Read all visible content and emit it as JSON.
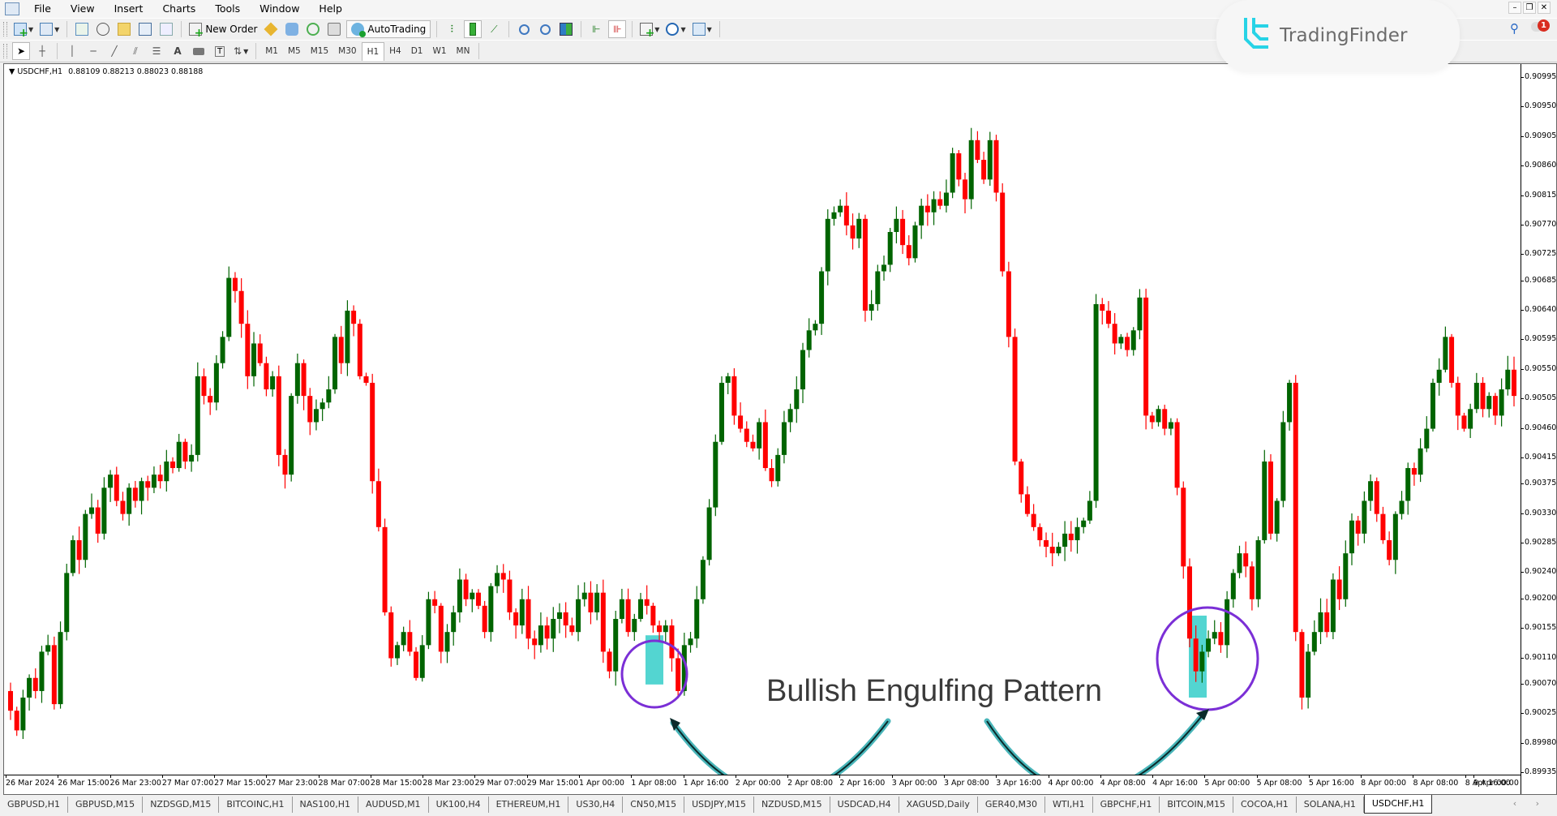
{
  "app": {
    "symbol_title": "USDCHF,H1",
    "ohlc_readout": "0.88109 0.88213 0.88023 0.88188"
  },
  "menu": [
    "File",
    "View",
    "Insert",
    "Charts",
    "Tools",
    "Window",
    "Help"
  ],
  "toolbar": {
    "new_order_label": "New Order",
    "autotrading_label": "AutoTrading",
    "timeframes": [
      "M1",
      "M5",
      "M15",
      "M30",
      "H1",
      "H4",
      "D1",
      "W1",
      "MN"
    ],
    "active_timeframe": "H1"
  },
  "branding": {
    "logo_text": "TradingFinder",
    "notification_count": "1"
  },
  "window_controls": {
    "minimize": "–",
    "restore": "❐",
    "close": "✕"
  },
  "colors": {
    "bull": "#006400",
    "bear": "#ff0000",
    "highlight": "#40d0cc",
    "circle": "#7b2fd6",
    "arrow": "#1aa3a8"
  },
  "annotation": {
    "label": "Bullish Engulfing Pattern"
  },
  "tabs": [
    "GBPUSD,H1",
    "GBPUSD,M15",
    "NZDSGD,M15",
    "BITCOINC,H1",
    "NAS100,H1",
    "AUDUSD,M1",
    "UK100,H4",
    "ETHEREUM,H1",
    "US30,H4",
    "CN50,M15",
    "USDJPY,M15",
    "NZDUSD,M15",
    "USDCAD,H4",
    "XAGUSD,Daily",
    "GER40,M30",
    "WTI,H1",
    "GBPCHF,H1",
    "BITCOIN,M15",
    "COCOA,H1",
    "SOLANA,H1",
    "USDCHF,H1"
  ],
  "active_tab": "USDCHF,H1",
  "chart_data": {
    "type": "candlestick",
    "title": "USDCHF,H1",
    "ylim": [
      0.89935,
      0.90995
    ],
    "y_ticks": [
      "0.90995",
      "0.90950",
      "0.90905",
      "0.90860",
      "0.90815",
      "0.90770",
      "0.90725",
      "0.90685",
      "0.90640",
      "0.90595",
      "0.90550",
      "0.90505",
      "0.90460",
      "0.90415",
      "0.90375",
      "0.90330",
      "0.90285",
      "0.90240",
      "0.90200",
      "0.90155",
      "0.90110",
      "0.90070",
      "0.90025",
      "0.89980",
      "0.89935"
    ],
    "x_ticks": [
      "26 Mar 2024",
      "26 Mar 15:00",
      "26 Mar 23:00",
      "27 Mar 07:00",
      "27 Mar 15:00",
      "27 Mar 23:00",
      "28 Mar 07:00",
      "28 Mar 15:00",
      "28 Mar 23:00",
      "29 Mar 07:00",
      "29 Mar 15:00",
      "1 Apr 00:00",
      "1 Apr 08:00",
      "1 Apr 16:00",
      "2 Apr 00:00",
      "2 Apr 08:00",
      "2 Apr 16:00",
      "3 Apr 00:00",
      "3 Apr 08:00",
      "3 Apr 16:00",
      "4 Apr 00:00",
      "4 Apr 08:00",
      "4 Apr 16:00",
      "5 Apr 00:00",
      "5 Apr 08:00",
      "5 Apr 16:00",
      "8 Apr 00:00",
      "8 Apr 08:00",
      "8 Apr 16:00",
      "9 Apr 00:00"
    ],
    "close_path": [
      0.9003,
      0.9,
      0.9005,
      0.9008,
      0.9006,
      0.9012,
      0.9013,
      0.9004,
      0.9015,
      0.9024,
      0.9029,
      0.9026,
      0.9033,
      0.9034,
      0.903,
      0.9037,
      0.9039,
      0.9035,
      0.9033,
      0.9037,
      0.9035,
      0.9038,
      0.9037,
      0.9039,
      0.9038,
      0.9041,
      0.904,
      0.9044,
      0.9041,
      0.9042,
      0.9054,
      0.9051,
      0.905,
      0.9056,
      0.906,
      0.9069,
      0.9067,
      0.9062,
      0.9054,
      0.9059,
      0.9056,
      0.9052,
      0.9054,
      0.9042,
      0.9039,
      0.9051,
      0.9056,
      0.9051,
      0.9047,
      0.9049,
      0.905,
      0.9052,
      0.906,
      0.9056,
      0.9064,
      0.9062,
      0.9054,
      0.9053,
      0.9038,
      0.9031,
      0.9018,
      0.9011,
      0.9013,
      0.9015,
      0.9012,
      0.9008,
      0.9013,
      0.902,
      0.9019,
      0.9012,
      0.9015,
      0.9018,
      0.9023,
      0.902,
      0.9021,
      0.9019,
      0.9015,
      0.9022,
      0.9024,
      0.9023,
      0.9018,
      0.9016,
      0.902,
      0.9014,
      0.9013,
      0.9016,
      0.9014,
      0.9017,
      0.9018,
      0.9016,
      0.9015,
      0.902,
      0.9021,
      0.9018,
      0.9021,
      0.9012,
      0.9009,
      0.9017,
      0.902,
      0.9015,
      0.9017,
      0.902,
      0.9019,
      0.9016,
      0.9015,
      0.9016,
      0.9011,
      0.9006,
      0.9013,
      0.9014,
      0.902,
      0.9026,
      0.9034,
      0.9044,
      0.9053,
      0.9054,
      0.9048,
      0.9046,
      0.9044,
      0.9043,
      0.9047,
      0.904,
      0.9038,
      0.9042,
      0.9047,
      0.9049,
      0.9052,
      0.9058,
      0.9061,
      0.9062,
      0.907,
      0.9078,
      0.9079,
      0.908,
      0.9077,
      0.9075,
      0.9078,
      0.9064,
      0.9065,
      0.907,
      0.9071,
      0.9076,
      0.9078,
      0.9074,
      0.9072,
      0.9077,
      0.908,
      0.9079,
      0.9081,
      0.908,
      0.9082,
      0.9088,
      0.9084,
      0.9081,
      0.909,
      0.9087,
      0.9084,
      0.909,
      0.9082,
      0.907,
      0.906,
      0.9041,
      0.9036,
      0.9033,
      0.9031,
      0.9029,
      0.9028,
      0.9027,
      0.9028,
      0.903,
      0.9029,
      0.9031,
      0.9032,
      0.9035,
      0.9065,
      0.9064,
      0.9062,
      0.9059,
      0.906,
      0.9058,
      0.9061,
      0.9066,
      0.9048,
      0.9047,
      0.9049,
      0.9046,
      0.9047,
      0.9037,
      0.9025,
      0.9014,
      0.9009,
      0.9012,
      0.9014,
      0.9015,
      0.9013,
      0.902,
      0.9024,
      0.9027,
      0.9025,
      0.902,
      0.9029,
      0.9041,
      0.903,
      0.9035,
      0.9047,
      0.9053,
      0.9015,
      0.9005,
      0.9012,
      0.9015,
      0.9018,
      0.9015,
      0.9023,
      0.902,
      0.9027,
      0.9032,
      0.903,
      0.9035,
      0.9038,
      0.9033,
      0.9029,
      0.9026,
      0.9033,
      0.9035,
      0.904,
      0.9039,
      0.9043,
      0.9046,
      0.9053,
      0.9055,
      0.906,
      0.9053,
      0.9048,
      0.9046,
      0.9049,
      0.9053,
      0.9049,
      0.9051,
      0.9048,
      0.9052,
      0.9055,
      0.9051
    ],
    "highlights": [
      {
        "label": "Bullish Engulfing Pattern",
        "zone": "1 Apr 08:00",
        "price_range": [
          0.9007,
          0.90145
        ]
      },
      {
        "label": "Bullish Engulfing Pattern",
        "zone": "5 Apr 00:00",
        "price_range": [
          0.9005,
          0.90175
        ]
      }
    ]
  }
}
